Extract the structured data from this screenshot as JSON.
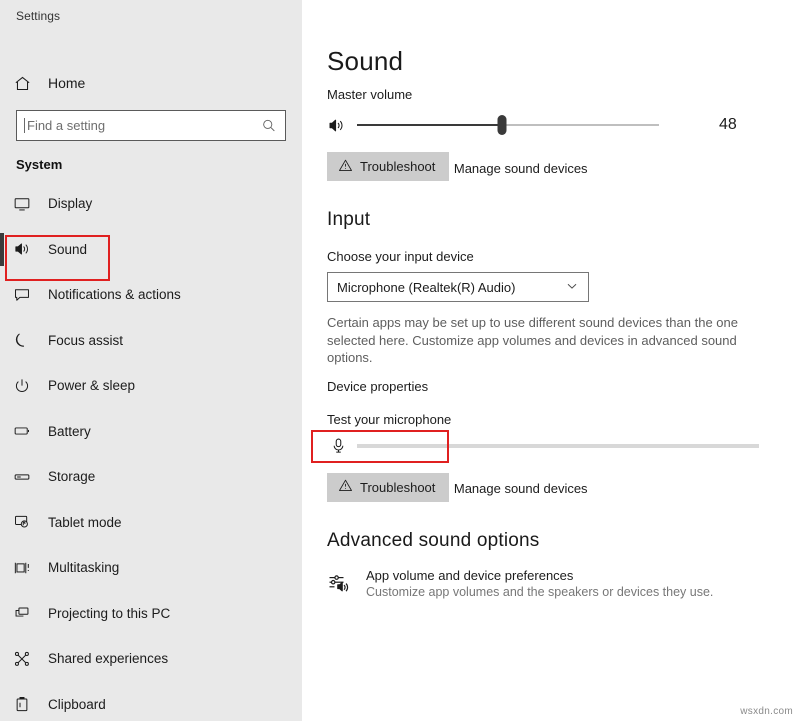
{
  "window": {
    "title": "Settings"
  },
  "sidebar": {
    "home": {
      "label": "Home",
      "icon": "home-icon"
    },
    "search": {
      "value": "",
      "placeholder": "Find a setting",
      "icon": "search-icon"
    },
    "group_title": "System",
    "items": [
      {
        "label": "Display",
        "icon": "monitor-icon",
        "selected": false
      },
      {
        "label": "Sound",
        "icon": "speaker-icon",
        "selected": true
      },
      {
        "label": "Notifications & actions",
        "icon": "chat-bubble-icon",
        "selected": false
      },
      {
        "label": "Focus assist",
        "icon": "moon-icon",
        "selected": false
      },
      {
        "label": "Power & sleep",
        "icon": "power-icon",
        "selected": false
      },
      {
        "label": "Battery",
        "icon": "battery-icon",
        "selected": false
      },
      {
        "label": "Storage",
        "icon": "drive-icon",
        "selected": false
      },
      {
        "label": "Tablet mode",
        "icon": "tablet-touch-icon",
        "selected": false
      },
      {
        "label": "Multitasking",
        "icon": "multitasking-icon",
        "selected": false
      },
      {
        "label": "Projecting to this PC",
        "icon": "project-screen-icon",
        "selected": false
      },
      {
        "label": "Shared experiences",
        "icon": "share-nodes-icon",
        "selected": false
      },
      {
        "label": "Clipboard",
        "icon": "clipboard-icon",
        "selected": false
      }
    ]
  },
  "main": {
    "page_title": "Sound",
    "output": {
      "master_volume_label": "Master volume",
      "volume_value": "48",
      "volume_percent": 48,
      "speaker_icon": "speaker-icon",
      "troubleshoot_label": "Troubleshoot",
      "troubleshoot_icon": "warning-triangle-icon",
      "manage_devices_link": "Manage sound devices"
    },
    "input": {
      "section_title": "Input",
      "choose_device_label": "Choose your input device",
      "selected_device": "Microphone (Realtek(R) Audio)",
      "dropdown_icon": "chevron-down-icon",
      "description": "Certain apps may be set up to use different sound devices than the one selected here. Customize app volumes and devices in advanced sound options.",
      "device_properties_link": "Device properties",
      "test_mic_label": "Test your microphone",
      "mic_icon": "microphone-icon",
      "mic_level_percent": 0,
      "troubleshoot_label": "Troubleshoot",
      "troubleshoot_icon": "warning-triangle-icon",
      "manage_devices_link": "Manage sound devices"
    },
    "advanced": {
      "section_title": "Advanced sound options",
      "items": [
        {
          "icon": "equalizer-speaker-icon",
          "title": "App volume and device preferences",
          "subtitle": "Customize app volumes and the speakers or devices they use."
        }
      ]
    }
  },
  "annotations": {
    "highlight_color": "#e02020",
    "boxes": [
      "sidebar-item-sound",
      "device-properties-link"
    ]
  },
  "watermark": {
    "text": "wsxdn.com"
  }
}
